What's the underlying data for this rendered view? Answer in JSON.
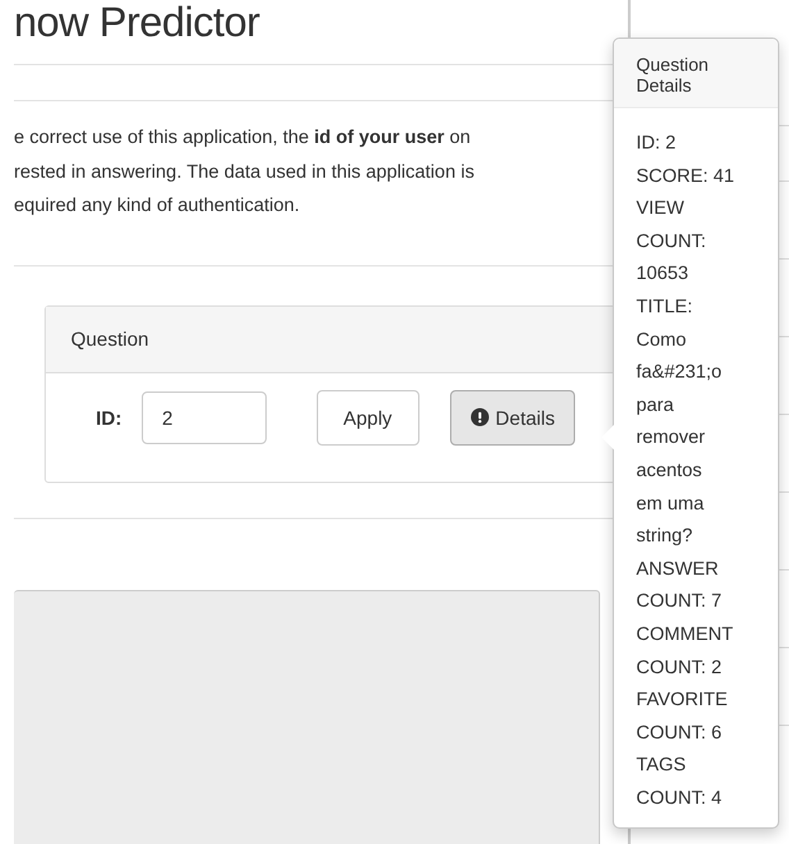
{
  "page_title": "now Predictor",
  "intro_lines": [
    "e correct use of this application, the **id of your user** on",
    "rested in answering. The data used in this application is",
    "equired any kind of authentication."
  ],
  "question_panel": {
    "heading": "Question",
    "id_label": "ID:",
    "id_value": "2",
    "apply_button": "Apply",
    "details_button": "Details"
  },
  "popover": {
    "title": "Question Details",
    "lines": [
      "ID: 2",
      "SCORE: 41",
      "VIEW",
      "COUNT:",
      "10653",
      "TITLE:",
      "Como",
      "fa&#231;o",
      "para",
      "remover",
      "acentos",
      "em uma",
      "string?",
      "ANSWER",
      "COUNT: 7",
      "COMMENT",
      "COUNT: 2",
      "FAVORITE",
      "COUNT: 6",
      "TAGS",
      "COUNT: 4"
    ]
  }
}
